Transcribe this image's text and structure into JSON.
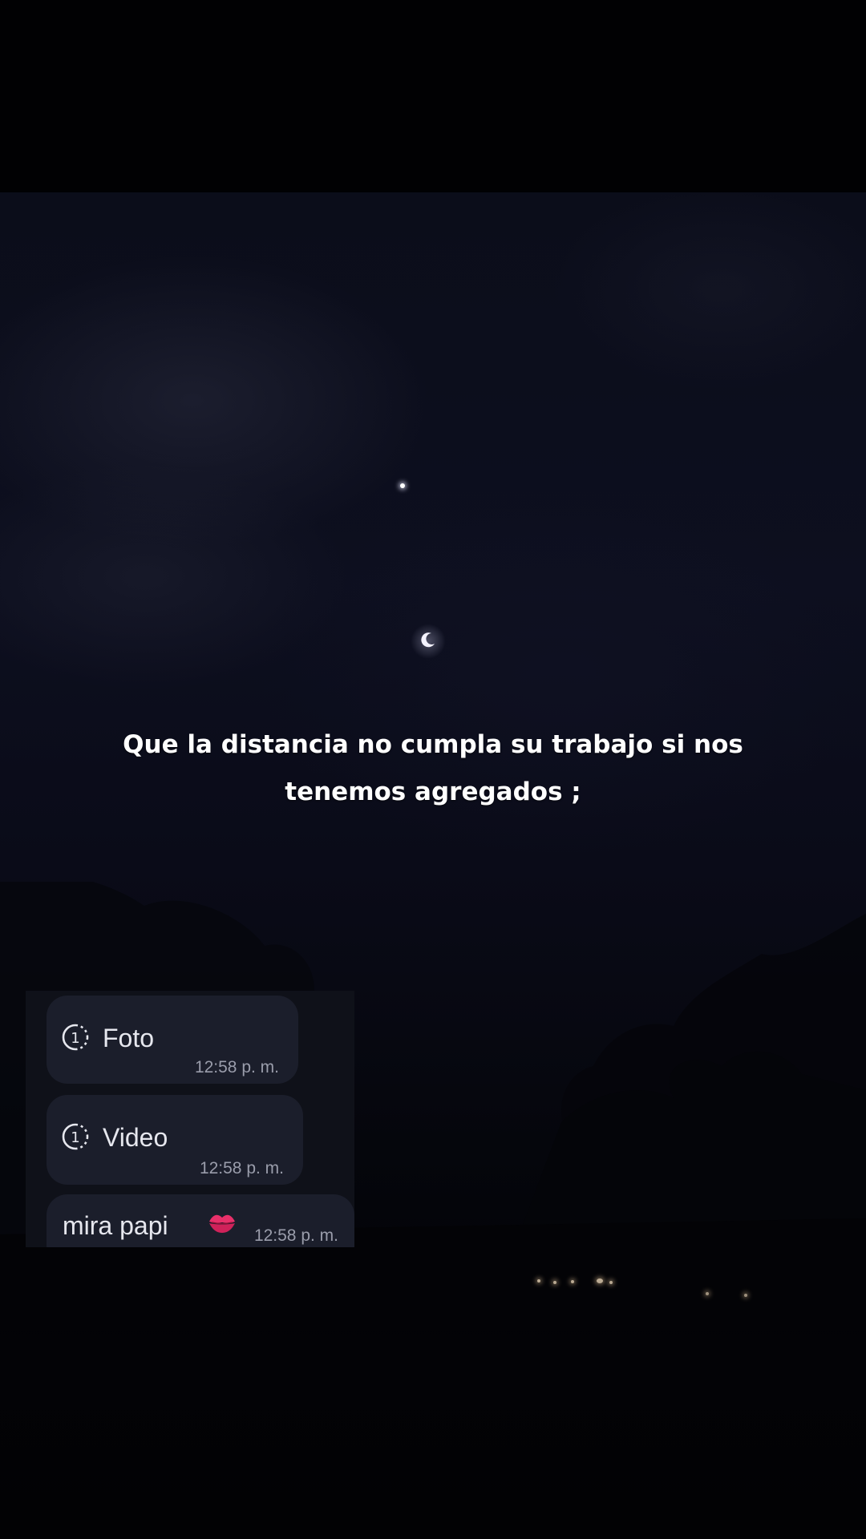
{
  "caption": {
    "text": "Que la distancia no cumpla su trabajo si nos tenemos agregados ;"
  },
  "chat": {
    "messages": [
      {
        "icon": "view-once-icon",
        "label": "Foto",
        "time": "12:58 p. m."
      },
      {
        "icon": "view-once-icon",
        "label": "Video",
        "time": "12:58 p. m."
      },
      {
        "label": "mira papi",
        "emoji": "kiss-mark-emoji",
        "time": "12:58 p. m."
      }
    ]
  },
  "colors": {
    "background": "#020206",
    "sky": "#0d0f1f",
    "caption_text": "#ffffff",
    "chat_panel": "#0f1119",
    "bubble": "#1b1e2b",
    "bubble_text": "#e6e7ee",
    "timestamp": "#9a9dab",
    "kiss_emoji": "#e8306a"
  }
}
